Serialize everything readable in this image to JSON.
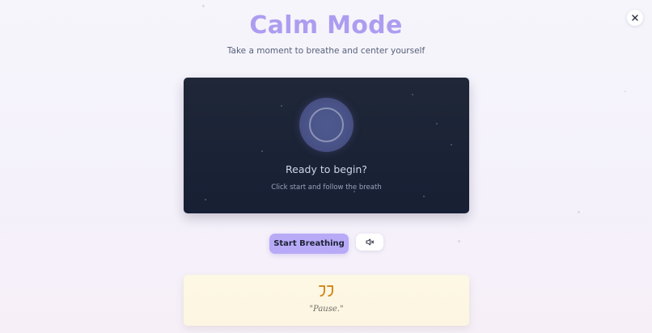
{
  "header": {
    "title": "Calm Mode",
    "subtitle": "Take a moment to breathe and center yourself"
  },
  "controls": {
    "close_icon": "close-icon",
    "start_label": "Start Breathing",
    "mute_icon": "speaker-muted-icon"
  },
  "breath_card": {
    "status": "Ready to begin?",
    "hint": "Click start and follow the breath"
  },
  "quote": {
    "icon": "quote-icon",
    "text": "\"Pause.\""
  },
  "colors": {
    "title": "#ad9df0",
    "accent_button": "#b8aaf6",
    "card_bg": "#1b2336",
    "orb": "#4a5387",
    "quote_icon": "#d38a1f",
    "quote_bg": "#fcf6e3"
  }
}
